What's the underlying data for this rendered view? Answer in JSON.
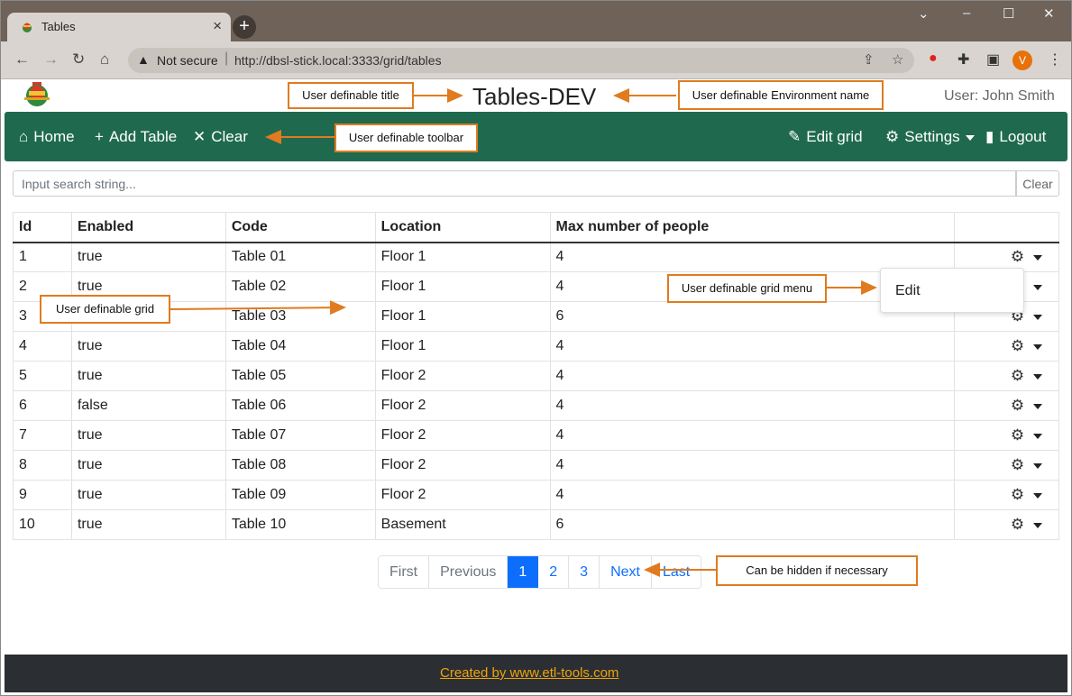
{
  "browser": {
    "tab_title": "Tables",
    "tab_close": "×",
    "new_tab": "+",
    "window_controls": [
      "⌄",
      "–",
      "☐",
      "✕"
    ],
    "security_label": "Not secure",
    "url": "http://dbsl-stick.local:3333/grid/tables",
    "profile_initial": "V",
    "accent_color": "#e8710a"
  },
  "app": {
    "title": "Tables-DEV",
    "user": "User: John Smith"
  },
  "toolbar": {
    "home": "Home",
    "add_table": "Add Table",
    "clear": "Clear",
    "edit_grid": "Edit grid",
    "settings": "Settings",
    "logout": "Logout",
    "background_color": "#1f6a4e"
  },
  "search": {
    "placeholder": "Input search string...",
    "clear_label": "Clear"
  },
  "grid": {
    "columns": [
      "Id",
      "Enabled",
      "Code",
      "Location",
      "Max number of people"
    ],
    "rows": [
      [
        "1",
        "true",
        "Table 01",
        "Floor 1",
        "4"
      ],
      [
        "2",
        "true",
        "Table 02",
        "Floor 1",
        "4"
      ],
      [
        "3",
        "",
        "Table 03",
        "Floor 1",
        "6"
      ],
      [
        "4",
        "true",
        "Table 04",
        "Floor 1",
        "4"
      ],
      [
        "5",
        "true",
        "Table 05",
        "Floor 2",
        "4"
      ],
      [
        "6",
        "false",
        "Table 06",
        "Floor 2",
        "4"
      ],
      [
        "7",
        "true",
        "Table 07",
        "Floor 2",
        "4"
      ],
      [
        "8",
        "true",
        "Table 08",
        "Floor 2",
        "4"
      ],
      [
        "9",
        "true",
        "Table 09",
        "Floor 2",
        "4"
      ],
      [
        "10",
        "true",
        "Table 10",
        "Basement",
        "6"
      ]
    ],
    "row_menu_item": "Edit"
  },
  "pagination": {
    "first": "First",
    "previous": "Previous",
    "pages": [
      "1",
      "2",
      "3"
    ],
    "active_page": "1",
    "next": "Next",
    "last": "Last"
  },
  "footer": {
    "link": "Created by www.etl-tools.com"
  },
  "annotations": {
    "title": "User definable title",
    "environment": "User definable Environment name",
    "toolbar": "User definable toolbar",
    "grid": "User definable grid",
    "grid_menu": "User definable grid menu",
    "pagination": "Can be hidden if necessary",
    "color": "#e07b1f"
  }
}
